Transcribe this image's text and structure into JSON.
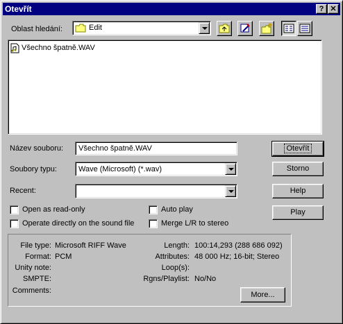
{
  "window": {
    "title": "Otevřít",
    "help_button": "?",
    "close_button": "✕"
  },
  "lookin": {
    "label": "Oblast hledání:",
    "value": "Edit"
  },
  "files": [
    {
      "name": "Všechno špatně.WAV",
      "icon": "wav-file-icon"
    }
  ],
  "filename": {
    "label": "Název souboru:",
    "value": "Všechno špatně.WAV"
  },
  "filetype": {
    "label": "Soubory typu:",
    "value": "Wave (Microsoft) (*.wav)"
  },
  "recent": {
    "label": "Recent:",
    "value": ""
  },
  "buttons": {
    "open": "Otevřít",
    "cancel": "Storno",
    "help": "Help",
    "play": "Play",
    "more": "More..."
  },
  "checkboxes": {
    "read_only": "Open as read-only",
    "operate_directly": "Operate directly on the sound file",
    "auto_play": "Auto play",
    "merge": "Merge L/R to stereo"
  },
  "info": {
    "file_type_label": "File type:",
    "file_type": "Microsoft RIFF Wave",
    "format_label": "Format:",
    "format": "PCM",
    "unity_label": "Unity note:",
    "unity": "",
    "smpte_label": "SMPTE:",
    "smpte": "",
    "comments_label": "Comments:",
    "comments": "",
    "length_label": "Length:",
    "length": "100:14,293 (288 686 092)",
    "attributes_label": "Attributes:",
    "attributes": "48 000 Hz; 16-bit; Stereo",
    "loops_label": "Loop(s):",
    "loops": "",
    "regions_label": "Rgns/Playlist:",
    "regions": "No/No"
  }
}
